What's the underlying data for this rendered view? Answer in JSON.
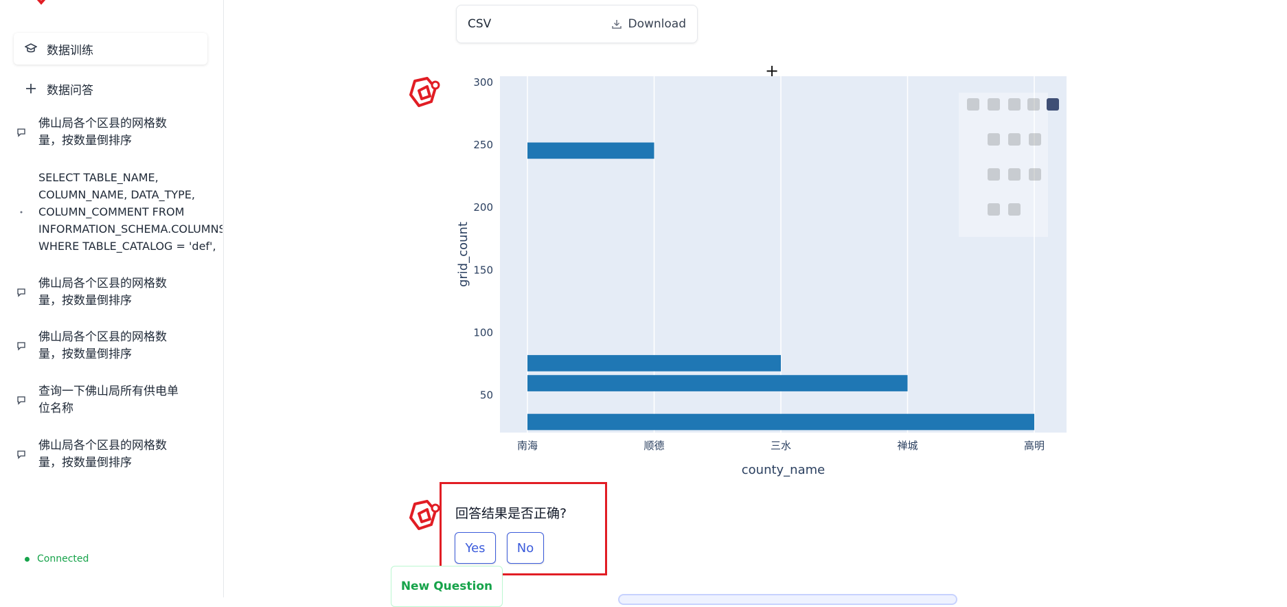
{
  "sidebar": {
    "nav": [
      {
        "label": "数据训练",
        "icon": "graduation-cap-icon"
      },
      {
        "label": "数据问答",
        "icon": "plus-icon"
      }
    ],
    "history": [
      {
        "text": "佛山局各个区县的网格数\n量，按数量倒排序",
        "icon": "message-icon"
      },
      {
        "text": "SELECT TABLE_NAME,\nCOLUMN_NAME, DATA_TYPE,\nCOLUMN_COMMENT FROM\nINFORMATION_SCHEMA.COLUMNS\nWHERE TABLE_CATALOG = 'def',",
        "icon": "message-icon"
      },
      {
        "text": "佛山局各个区县的网格数\n量，按数量倒排序",
        "icon": "message-icon"
      },
      {
        "text": "佛山局各个区县的网格数\n量，按数量倒排序",
        "icon": "message-icon"
      },
      {
        "text": "查询一下佛山局所有供电单\n位名称",
        "icon": "message-icon"
      },
      {
        "text": "佛山局各个区县的网格数\n量，按数量倒排序",
        "icon": "message-icon"
      }
    ],
    "status": "Connected",
    "status_color": "#16a34a"
  },
  "export": {
    "format_label": "CSV",
    "download_label": "Download"
  },
  "feedback": {
    "question": "回答结果是否正确?",
    "yes_label": "Yes",
    "no_label": "No"
  },
  "new_question_label": "New Question",
  "colors": {
    "bar": "#1f77b4",
    "plot_bg": "#e5ecf6",
    "highlight": "#e11d24",
    "brand": "#e11d24"
  },
  "chart_data": {
    "type": "bar",
    "orientation": "horizontal-overlay",
    "title": "",
    "xlabel": "county_name",
    "ylabel": "grid_count",
    "categories": [
      "南海",
      "顺德",
      "三水",
      "禅城",
      "高明"
    ],
    "y_ticks": [
      50,
      100,
      150,
      200,
      250,
      300
    ],
    "ylim": [
      20,
      305
    ],
    "bars": [
      {
        "x_start": "南海",
        "x_end": "顺德",
        "y_low": 239,
        "y_high": 252
      },
      {
        "x_start": "南海",
        "x_end": "三水",
        "y_low": 69,
        "y_high": 82
      },
      {
        "x_start": "南海",
        "x_end": "禅城",
        "y_low": 53,
        "y_high": 66
      },
      {
        "x_start": "南海",
        "x_end": "高明",
        "y_low": 22,
        "y_high": 35
      }
    ],
    "grid": true,
    "legend": "none",
    "modebar_icons": [
      "camera-icon",
      "zoom-icon",
      "zoom-in-icon",
      "spike-lines-icon",
      "plotly-logo-icon",
      "pan-icon",
      "zoom-out-icon",
      "hover-closest-icon",
      "box-select-icon",
      "autoscale-icon",
      "hover-compare-icon",
      "lasso-icon",
      "reset-axes-icon"
    ]
  }
}
